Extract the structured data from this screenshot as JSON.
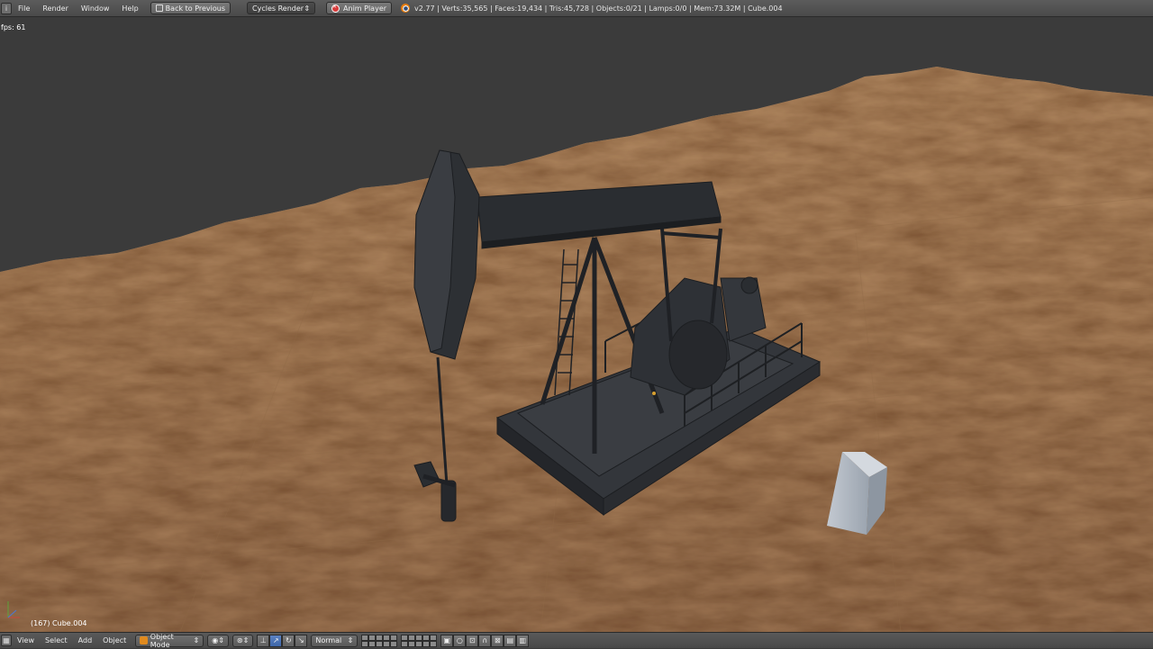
{
  "top_header": {
    "menus": [
      "File",
      "Render",
      "Window",
      "Help"
    ],
    "back_button": "Back to Previous",
    "render_engine": "Cycles Render",
    "anim_player": "Anim Player",
    "stats": "v2.77 | Verts:35,565 | Faces:19,434 | Tris:45,728 | Objects:0/21 | Lamps:0/0 | Mem:73.32M | Cube.004"
  },
  "viewport": {
    "fps": "fps: 61",
    "object_info": "(167) Cube.004"
  },
  "bottom_header": {
    "menus": [
      "View",
      "Select",
      "Add",
      "Object"
    ],
    "mode": "Object Mode",
    "orientation": "Normal"
  },
  "colors": {
    "header_bg": "#505050",
    "viewport_bg": "#3b3b3b",
    "terrain": "#a57c58",
    "pumpjack": "#2c2f33",
    "selected_cube": "#aab2bd",
    "accent_orange": "#e08a1e",
    "active_blue": "#4a72b6"
  }
}
